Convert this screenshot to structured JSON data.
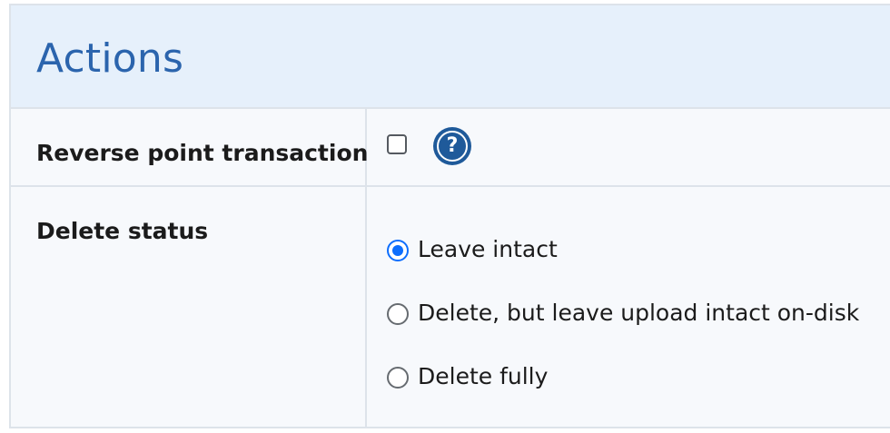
{
  "section": {
    "title": "Actions"
  },
  "fields": {
    "reverse_point_transaction": {
      "label": "Reverse point transaction",
      "checked": false,
      "help_icon": "question-circle-icon"
    },
    "delete_status": {
      "label": "Delete status",
      "options": [
        {
          "label": "Leave intact",
          "selected": true
        },
        {
          "label": "Delete, but leave upload intact on-disk",
          "selected": false
        },
        {
          "label": "Delete fully",
          "selected": false
        }
      ]
    }
  },
  "colors": {
    "header_bg": "#e6f0fb",
    "title": "#2b64ad",
    "accent": "#0d6efd",
    "help_icon": "#1f5a9a",
    "border": "#dde3ea",
    "panel_bg": "#f7f9fc"
  }
}
